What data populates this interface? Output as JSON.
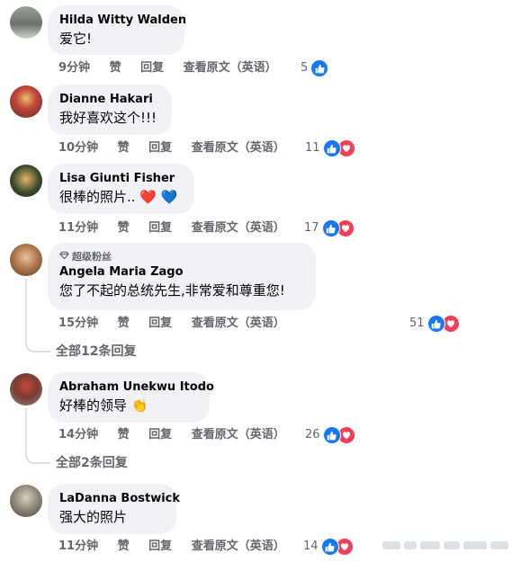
{
  "comments": [
    {
      "author": "Hilda Witty Walden",
      "text": "爱它!",
      "time": "9分钟",
      "like": "赞",
      "reply": "回复",
      "translate": "查看原文（英语）",
      "reaction_count": "5",
      "reactions": [
        "like"
      ]
    },
    {
      "author": "Dianne Hakari",
      "text": "我好喜欢这个!!!",
      "time": "10分钟",
      "like": "赞",
      "reply": "回复",
      "translate": "查看原文（英语）",
      "reaction_count": "11",
      "reactions": [
        "like",
        "love"
      ]
    },
    {
      "author": "Lisa Giunti Fisher",
      "text": "很棒的照片..",
      "emoji": "❤️ 💙",
      "time": "11分钟",
      "like": "赞",
      "reply": "回复",
      "translate": "查看原文（英语）",
      "reaction_count": "17",
      "reactions": [
        "like",
        "love"
      ]
    },
    {
      "badge": "超级粉丝",
      "author": "Angela Maria Zago",
      "text": "您了不起的总统先生,非常爱和尊重您!",
      "time": "15分钟",
      "like": "赞",
      "reply": "回复",
      "translate": "查看原文（英语）",
      "reaction_count": "51",
      "reactions": [
        "like",
        "love"
      ],
      "view_replies": "全部12条回复"
    },
    {
      "author": "Abraham Unekwu Itodo",
      "text": "好棒的领导",
      "emoji": "👏",
      "time": "14分钟",
      "like": "赞",
      "reply": "回复",
      "translate": "查看原文（英语）",
      "reaction_count": "26",
      "reactions": [
        "like",
        "love"
      ],
      "view_replies": "全部2条回复"
    },
    {
      "author": "LaDanna Bostwick",
      "text": "强大的照片",
      "time": "11分钟",
      "like": "赞",
      "reply": "回复",
      "translate": "查看原文（英语）",
      "reaction_count": "14",
      "reactions": [
        "like",
        "love"
      ]
    }
  ],
  "colors": {
    "bubble": "#f0f2f5",
    "like": "#1877f2",
    "love": "#f33e58",
    "meta": "#65676b"
  }
}
